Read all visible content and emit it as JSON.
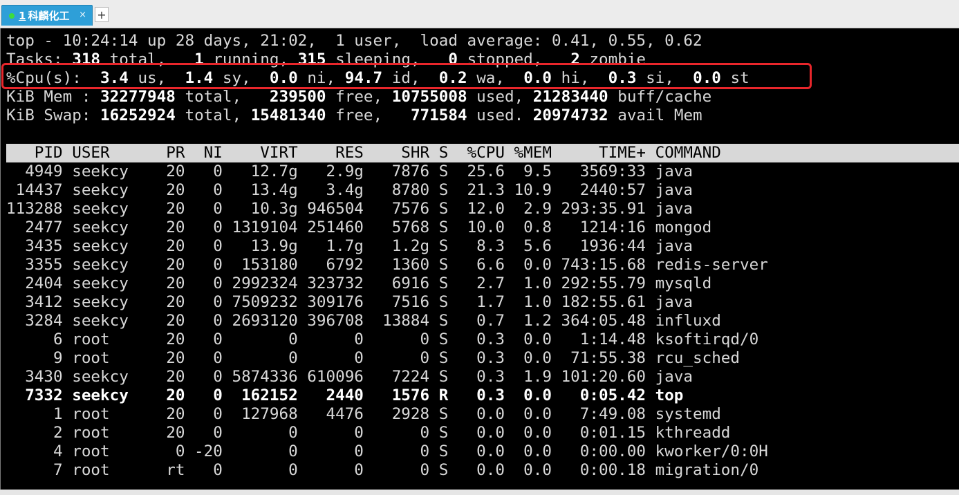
{
  "tabbar": {
    "tab_number": "1",
    "tab_title": "科麟化工",
    "close_symbol": "×",
    "new_tab_symbol": "+"
  },
  "colors": {
    "tab_active": "#2e9fd8",
    "status_dot": "#3ddc3d",
    "terminal_bg": "#000000",
    "terminal_fg": "#d8d8d8",
    "highlight_box": "#e8262b",
    "header_bg": "#d8d8d8"
  },
  "summary": {
    "line1": "top - 10:24:14 up 28 days, 21:02,  1 user,  load average: 0.41, 0.55, 0.62",
    "line2": {
      "prefix": "Tasks: ",
      "total": "318",
      "total_lbl": " total,   ",
      "running": "1",
      "running_lbl": " running, ",
      "sleeping": "315",
      "sleeping_lbl": " sleeping,   ",
      "stopped": "0",
      "stopped_lbl": " stopped,   ",
      "zombie": "2",
      "zombie_lbl": " zombie"
    },
    "line3": {
      "prefix": "%Cpu(s):  ",
      "us": "3.4",
      "us_lbl": " us,  ",
      "sy": "1.4",
      "sy_lbl": " sy,  ",
      "ni": "0.0",
      "ni_lbl": " ni, ",
      "id": "94.7",
      "id_lbl": " id,  ",
      "wa": "0.2",
      "wa_lbl": " wa,  ",
      "hi": "0.0",
      "hi_lbl": " hi,  ",
      "si": "0.3",
      "si_lbl": " si,  ",
      "st": "0.0",
      "st_lbl": " st"
    },
    "line4": {
      "prefix": "KiB Mem : ",
      "total": "32277948",
      "total_lbl": " total,   ",
      "free": "239500",
      "free_lbl": " free, ",
      "used": "10755008",
      "used_lbl": " used, ",
      "cache": "21283440",
      "cache_lbl": " buff/cache"
    },
    "line5": {
      "prefix": "KiB Swap: ",
      "total": "16252924",
      "total_lbl": " total, ",
      "free": "15481340",
      "free_lbl": " free,   ",
      "used": "771584",
      "used_lbl": " used. ",
      "avail": "20974732",
      "avail_lbl": " avail Mem"
    }
  },
  "table_header": "   PID USER      PR  NI    VIRT    RES    SHR S  %CPU %MEM     TIME+ COMMAND",
  "processes": [
    {
      "text": "  4949 seekcy    20   0   12.7g   2.9g   7876 S  25.6  9.5   3569:33 java",
      "bold": false
    },
    {
      "text": " 14437 seekcy    20   0   13.4g   3.4g   8780 S  21.3 10.9   2440:57 java",
      "bold": false
    },
    {
      "text": "113288 seekcy    20   0   10.3g 946504   7576 S  12.0  2.9 293:35.91 java",
      "bold": false
    },
    {
      "text": "  2477 seekcy    20   0 1319104 251460   5768 S  10.0  0.8   1214:16 mongod",
      "bold": false
    },
    {
      "text": "  3435 seekcy    20   0   13.9g   1.7g   1.2g S   8.3  5.6   1936:44 java",
      "bold": false
    },
    {
      "text": "  3355 seekcy    20   0  153180   6792   1360 S   6.6  0.0 743:15.68 redis-server",
      "bold": false
    },
    {
      "text": "  2404 seekcy    20   0 2992324 323732   6916 S   2.7  1.0 292:55.79 mysqld",
      "bold": false
    },
    {
      "text": "  3412 seekcy    20   0 7509232 309176   7516 S   1.7  1.0 182:55.61 java",
      "bold": false
    },
    {
      "text": "  3284 seekcy    20   0 2693120 396708  13884 S   0.7  1.2 364:05.48 influxd",
      "bold": false
    },
    {
      "text": "     6 root      20   0       0      0      0 S   0.3  0.0   1:14.48 ksoftirqd/0",
      "bold": false
    },
    {
      "text": "     9 root      20   0       0      0      0 S   0.3  0.0  71:55.38 rcu_sched",
      "bold": false
    },
    {
      "text": "  3430 seekcy    20   0 5874336 610096   7224 S   0.3  1.9 101:20.60 java",
      "bold": false
    },
    {
      "text": "  7332 seekcy    20   0  162152   2440   1576 R   0.3  0.0   0:05.42 top",
      "bold": true
    },
    {
      "text": "     1 root      20   0  127968   4476   2928 S   0.0  0.0   7:49.08 systemd",
      "bold": false
    },
    {
      "text": "     2 root      20   0       0      0      0 S   0.0  0.0   0:01.15 kthreadd",
      "bold": false
    },
    {
      "text": "     4 root       0 -20       0      0      0 S   0.0  0.0   0:00.00 kworker/0:0H",
      "bold": false
    },
    {
      "text": "     7 root      rt   0       0      0      0 S   0.0  0.0   0:00.18 migration/0",
      "bold": false
    }
  ]
}
